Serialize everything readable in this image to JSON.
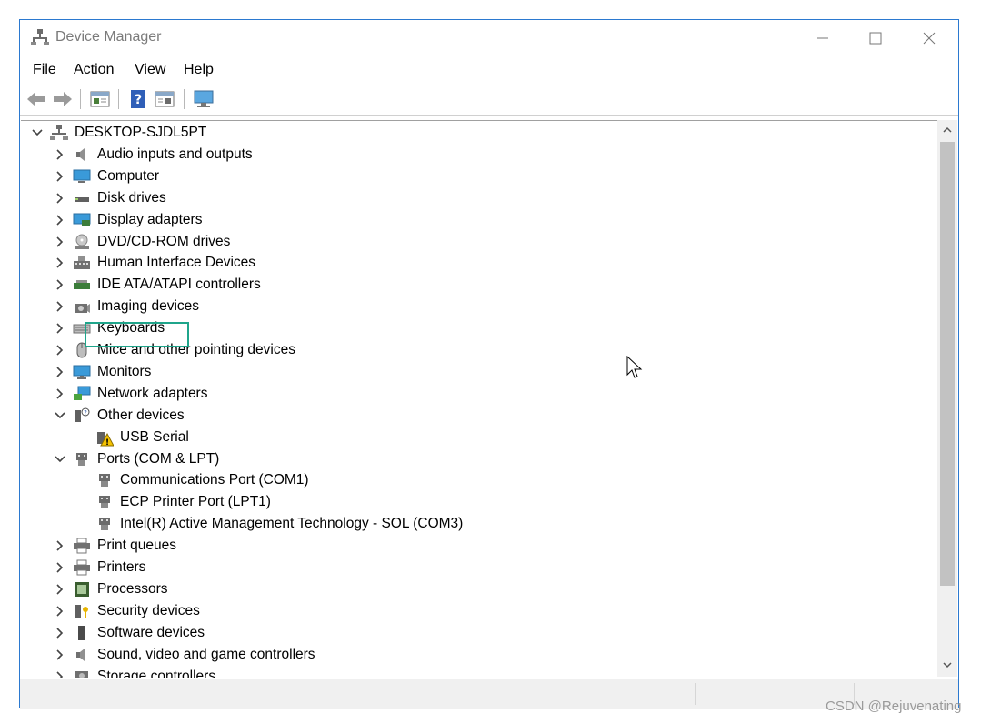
{
  "window": {
    "title": "Device Manager",
    "accent": "#2b79d0"
  },
  "menu": [
    "File",
    "Action",
    "View",
    "Help"
  ],
  "toolbar": [
    "back-arrow-icon",
    "forward-arrow-icon",
    "properties-icon",
    "help-icon",
    "update-icon",
    "monitor-icon"
  ],
  "tree": {
    "root": "DESKTOP-SJDL5PT",
    "items": [
      {
        "label": "Audio inputs and outputs",
        "icon": "speaker-icon",
        "expanded": false
      },
      {
        "label": "Computer",
        "icon": "computer-icon",
        "expanded": false
      },
      {
        "label": "Disk drives",
        "icon": "disk-icon",
        "expanded": false
      },
      {
        "label": "Display adapters",
        "icon": "display-adapter-icon",
        "expanded": false
      },
      {
        "label": "DVD/CD-ROM drives",
        "icon": "dvd-icon",
        "expanded": false
      },
      {
        "label": "Human Interface Devices",
        "icon": "hid-icon",
        "expanded": false
      },
      {
        "label": "IDE ATA/ATAPI controllers",
        "icon": "ide-icon",
        "expanded": false
      },
      {
        "label": "Imaging devices",
        "icon": "camera-icon",
        "expanded": false
      },
      {
        "label": "Keyboards",
        "icon": "keyboard-icon",
        "expanded": false
      },
      {
        "label": "Mice and other pointing devices",
        "icon": "mouse-icon",
        "expanded": false
      },
      {
        "label": "Monitors",
        "icon": "monitor-icon",
        "expanded": false
      },
      {
        "label": "Network adapters",
        "icon": "network-icon",
        "expanded": false
      },
      {
        "label": "Other devices",
        "icon": "other-devices-icon",
        "expanded": true,
        "children": [
          {
            "label": "USB Serial",
            "icon": "warning-device-icon"
          }
        ]
      },
      {
        "label": "Ports (COM & LPT)",
        "icon": "port-icon",
        "expanded": true,
        "children": [
          {
            "label": "Communications Port (COM1)",
            "icon": "port-icon"
          },
          {
            "label": "ECP Printer Port (LPT1)",
            "icon": "port-icon"
          },
          {
            "label": "Intel(R) Active Management Technology - SOL (COM3)",
            "icon": "port-icon"
          }
        ]
      },
      {
        "label": "Print queues",
        "icon": "printer-icon",
        "expanded": false
      },
      {
        "label": "Printers",
        "icon": "printer-icon",
        "expanded": false
      },
      {
        "label": "Processors",
        "icon": "processor-icon",
        "expanded": false
      },
      {
        "label": "Security devices",
        "icon": "security-icon",
        "expanded": false
      },
      {
        "label": "Software devices",
        "icon": "software-icon",
        "expanded": false
      },
      {
        "label": "Sound, video and game controllers",
        "icon": "speaker-icon",
        "expanded": false
      },
      {
        "label": "Storage controllers",
        "icon": "storage-icon",
        "expanded": false
      }
    ]
  },
  "highlight_color": "#1fa58b",
  "watermark": "CSDN @Rejuvenating"
}
